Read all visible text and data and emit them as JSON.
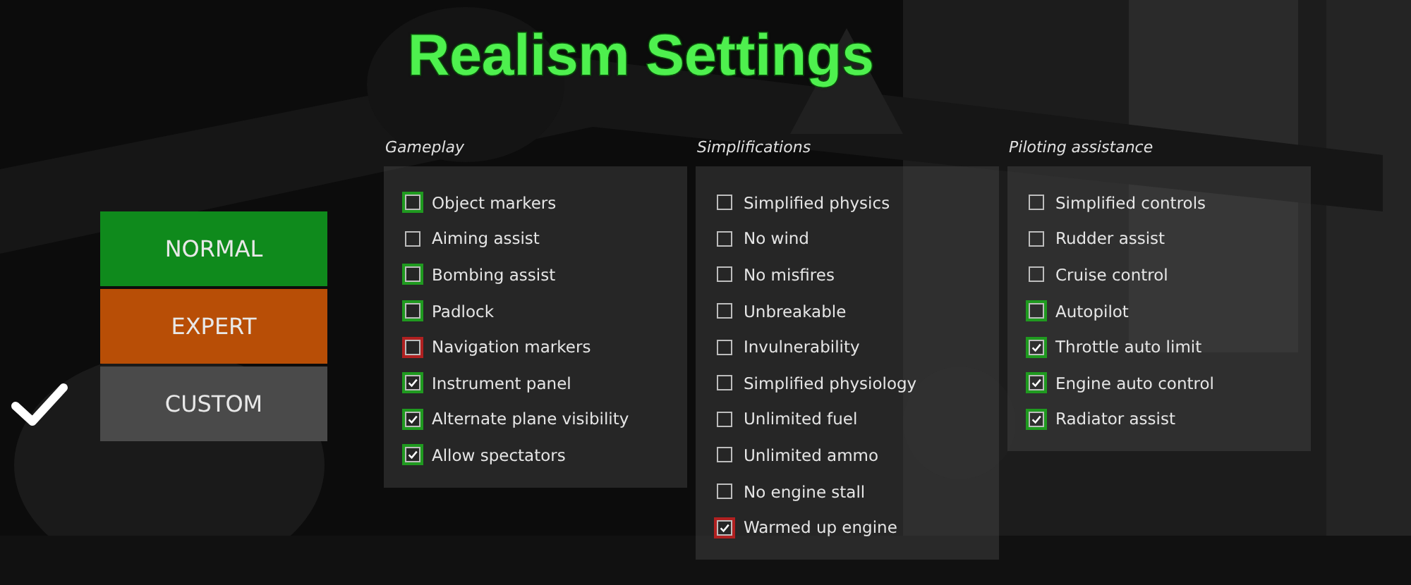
{
  "title": "Realism Settings",
  "presets": [
    {
      "label": "NORMAL",
      "color": "#0f8a1c",
      "selected": false
    },
    {
      "label": "EXPERT",
      "color": "#b84e06",
      "selected": false
    },
    {
      "label": "CUSTOM",
      "color": "#4a4a4a",
      "selected": true
    }
  ],
  "groups": [
    {
      "heading": "Gameplay",
      "items": [
        {
          "label": "Object markers",
          "checked": false,
          "color": "#1f9a1f"
        },
        {
          "label": "Aiming assist",
          "checked": false
        },
        {
          "label": "Bombing assist",
          "checked": false,
          "color": "#1f9a1f"
        },
        {
          "label": "Padlock",
          "checked": false,
          "color": "#1f9a1f"
        },
        {
          "label": "Navigation markers",
          "checked": false,
          "color": "#b02020"
        },
        {
          "label": "Instrument panel",
          "checked": true,
          "color": "#1f9a1f"
        },
        {
          "label": "Alternate plane visibility",
          "checked": true,
          "color": "#1f9a1f"
        },
        {
          "label": "Allow spectators",
          "checked": true,
          "color": "#1f9a1f"
        }
      ]
    },
    {
      "heading": "Simplifications",
      "items": [
        {
          "label": "Simplified physics",
          "checked": false
        },
        {
          "label": "No wind",
          "checked": false
        },
        {
          "label": "No misfires",
          "checked": false
        },
        {
          "label": "Unbreakable",
          "checked": false
        },
        {
          "label": "Invulnerability",
          "checked": false
        },
        {
          "label": "Simplified physiology",
          "checked": false
        },
        {
          "label": "Unlimited fuel",
          "checked": false
        },
        {
          "label": "Unlimited ammo",
          "checked": false
        },
        {
          "label": "No engine stall",
          "checked": false
        },
        {
          "label": "Warmed up engine",
          "checked": true,
          "color": "#b02020"
        }
      ]
    },
    {
      "heading": "Piloting assistance",
      "items": [
        {
          "label": "Simplified controls",
          "checked": false
        },
        {
          "label": "Rudder assist",
          "checked": false
        },
        {
          "label": "Cruise control",
          "checked": false
        },
        {
          "label": "Autopilot",
          "checked": false,
          "color": "#1f9a1f"
        },
        {
          "label": "Throttle auto limit",
          "checked": true,
          "color": "#1f9a1f"
        },
        {
          "label": "Engine auto control",
          "checked": true,
          "color": "#1f9a1f"
        },
        {
          "label": "Radiator assist",
          "checked": true,
          "color": "#1f9a1f"
        }
      ]
    }
  ]
}
